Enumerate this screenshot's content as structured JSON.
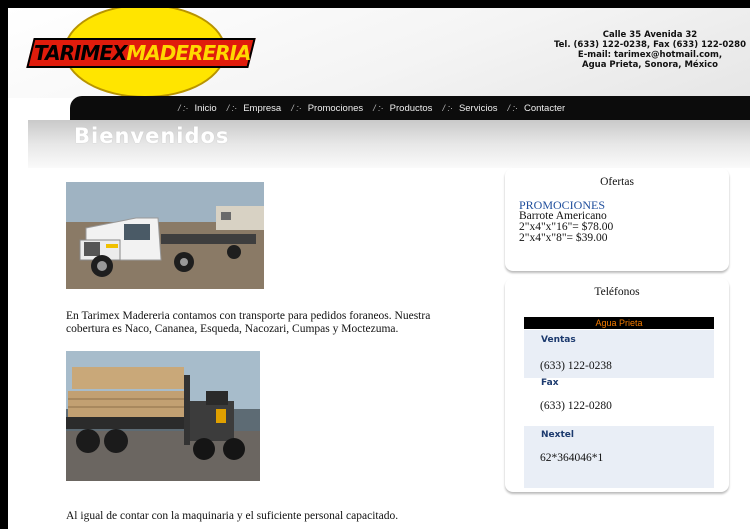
{
  "logo": {
    "part1": "TARIMEX",
    "part2": "MADERERIA"
  },
  "contact": {
    "line1": "Calle 35 Avenida 32",
    "line2": "Tel. (633) 122-0238, Fax (633) 122-0280",
    "line3": "E-mail: tarimex@hotmail.com,",
    "line4": "Agua Prieta, Sonora, México"
  },
  "nav": {
    "items": [
      {
        "label": "Inicio"
      },
      {
        "label": "Empresa"
      },
      {
        "label": "Promociones"
      },
      {
        "label": "Productos"
      },
      {
        "label": "Servicios"
      },
      {
        "label": "Contacter"
      }
    ]
  },
  "welcome": "Bienvenidos",
  "main": {
    "paragraph1": "En Tarimex Madereria contamos con transporte para pedidos foraneos. Nuestra cobertura es Naco, Cananea, Esqueda, Nacozari, Cumpas y Moctezuma.",
    "paragraph2": "Al igual de contar con la maquinaria y el suficiente personal capacitado."
  },
  "ofertas": {
    "title": "Ofertas",
    "heading": "PROMOCIONES",
    "line1": "Barrote Americano",
    "line2": "2\"x4\"x\"16\"= $78.00",
    "line3": "2\"x4\"x\"8\"= $39.00"
  },
  "telefonos": {
    "title": "Teléfonos",
    "region": "Agua Prieta",
    "ventas_label": "Ventas",
    "ventas_value": "(633) 122-0238",
    "fax_label": "Fax",
    "fax_value": "(633) 122-0280",
    "nextel_label": "Nextel",
    "nextel_value": "62*364046*1"
  },
  "colors": {
    "nav": "#0c0c0c",
    "logo_yellow": "#ffe500",
    "logo_red": "#e01c0c",
    "promo": "#1f4e9c",
    "region": "#f57c00"
  }
}
